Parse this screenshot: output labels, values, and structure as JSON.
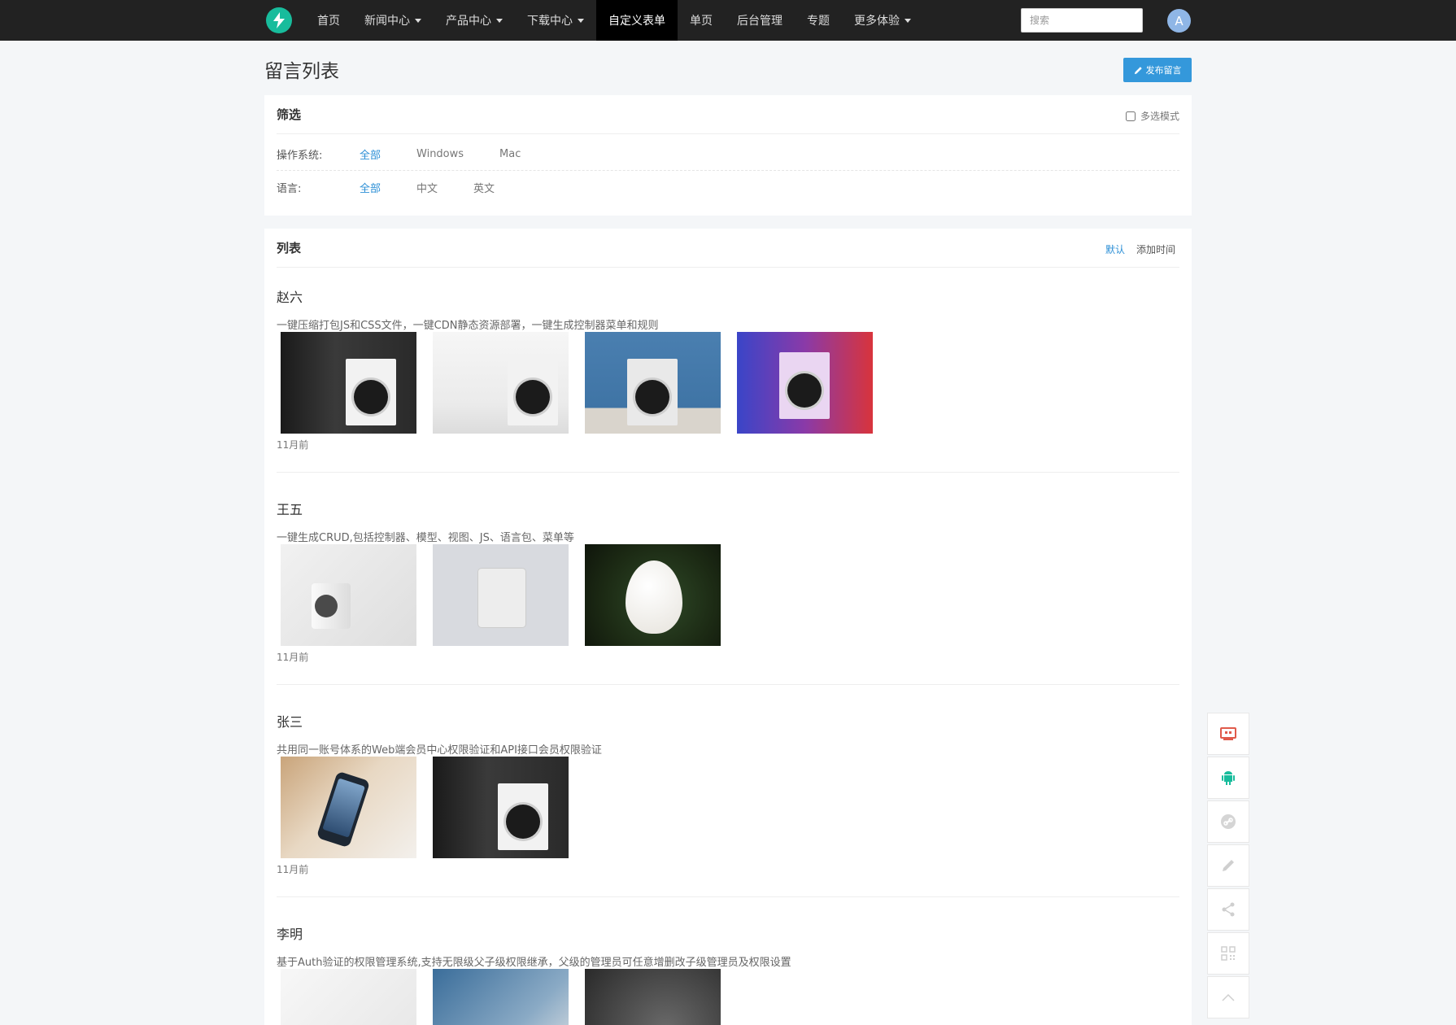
{
  "nav": {
    "items": [
      {
        "label": "首页",
        "dropdown": false
      },
      {
        "label": "新闻中心",
        "dropdown": true
      },
      {
        "label": "产品中心",
        "dropdown": true
      },
      {
        "label": "下载中心",
        "dropdown": true
      },
      {
        "label": "自定义表单",
        "dropdown": false,
        "active": true
      },
      {
        "label": "单页",
        "dropdown": false
      },
      {
        "label": "后台管理",
        "dropdown": false
      },
      {
        "label": "专题",
        "dropdown": false
      },
      {
        "label": "更多体验",
        "dropdown": true
      }
    ],
    "search_placeholder": "搜索",
    "avatar_letter": "A",
    "brand_icon": "lightning-icon"
  },
  "page": {
    "title": "留言列表",
    "post_button": "发布留言"
  },
  "filter": {
    "title": "筛选",
    "multi_mode": "多选模式",
    "rows": [
      {
        "label": "操作系统:",
        "options": [
          "全部",
          "Windows",
          "Mac"
        ],
        "active": 0
      },
      {
        "label": "语言:",
        "options": [
          "全部",
          "中文",
          "英文"
        ],
        "active": 0
      }
    ]
  },
  "list": {
    "title": "列表",
    "sort": [
      "默认",
      "添加时间"
    ],
    "sort_active": 0,
    "entries": [
      {
        "name": "赵六",
        "desc": "一键压缩打包JS和CSS文件，一键CDN静态资源部署，一键生成控制器菜单和规则",
        "time": "11月前",
        "images": 4
      },
      {
        "name": "王五",
        "desc": "一键生成CRUD,包括控制器、模型、视图、JS、语言包、菜单等",
        "time": "11月前",
        "images": 3
      },
      {
        "name": "张三",
        "desc": "共用同一账号体系的Web端会员中心权限验证和API接口会员权限验证",
        "time": "11月前",
        "images": 2
      },
      {
        "name": "李明",
        "desc": "基于Auth验证的权限管理系统,支持无限级父子级权限继承，父级的管理员可任意增删改子级管理员及权限设置",
        "time": "",
        "images": 3
      }
    ]
  },
  "float_toolbar": [
    "monitor-icon",
    "android-icon",
    "link-icon",
    "pencil-icon",
    "share-icon",
    "qrcode-icon",
    "chevron-up-icon"
  ],
  "colors": {
    "accent": "#2c8fd6",
    "brand": "#18bc9c",
    "navbar": "#222222",
    "button": "#3498db"
  }
}
